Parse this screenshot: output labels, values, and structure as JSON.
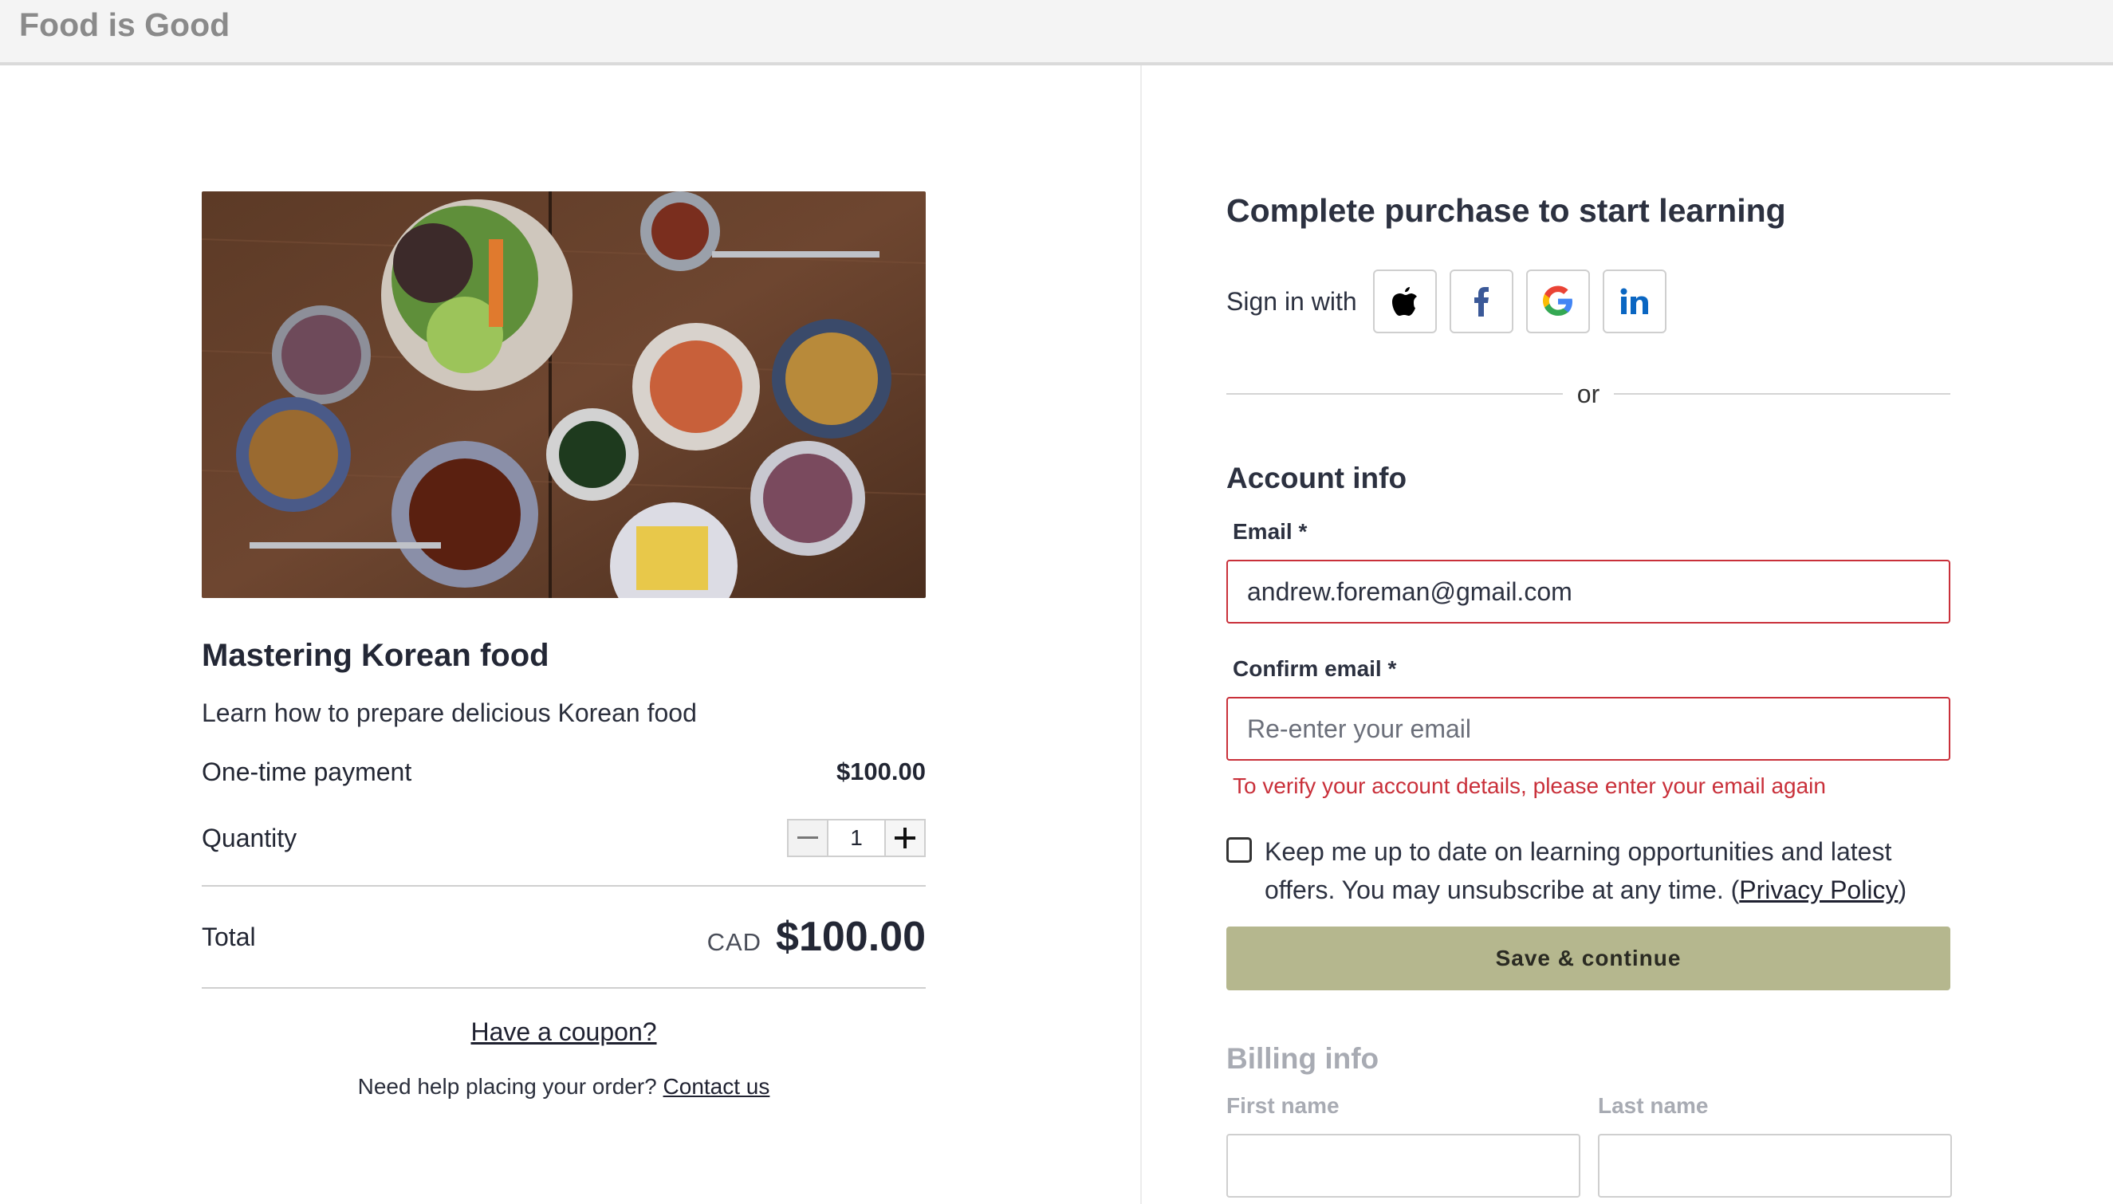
{
  "brand": "Food is Good",
  "product": {
    "image_alt": "Korean food spread",
    "title": "Mastering Korean food",
    "description": "Learn how to prepare delicious Korean food",
    "payment_label": "One-time payment",
    "payment_price": "$100.00",
    "quantity_label": "Quantity",
    "quantity_value": "1",
    "total_label": "Total",
    "total_currency": "CAD",
    "total_value": "$100.00",
    "coupon_link": "Have a coupon?",
    "help_text": "Need help placing your order?",
    "help_link": "Contact us"
  },
  "checkout": {
    "heading": "Complete purchase to start learning",
    "signin_label": "Sign in with",
    "social": [
      "apple-icon",
      "facebook-icon",
      "google-icon",
      "linkedin-icon"
    ],
    "or_text": "or",
    "account_heading": "Account info",
    "email_label": "Email *",
    "email_value": "andrew.foreman@gmail.com",
    "confirm_label": "Confirm email *",
    "confirm_placeholder": "Re-enter your email",
    "error_text": "To verify your account details, please enter your email again",
    "newsletter_text": "Keep me up to date on learning opportunities and latest offers. You may unsubscribe at any time. (",
    "privacy_link": "Privacy Policy",
    "newsletter_close": ")",
    "save_button": "Save & continue",
    "billing_heading": "Billing info",
    "first_name_label": "First name",
    "last_name_label": "Last name"
  },
  "colors": {
    "error": "#c9303a",
    "button": "#b5b78e",
    "facebook": "#3b5998",
    "linkedin": "#0a66c2"
  }
}
